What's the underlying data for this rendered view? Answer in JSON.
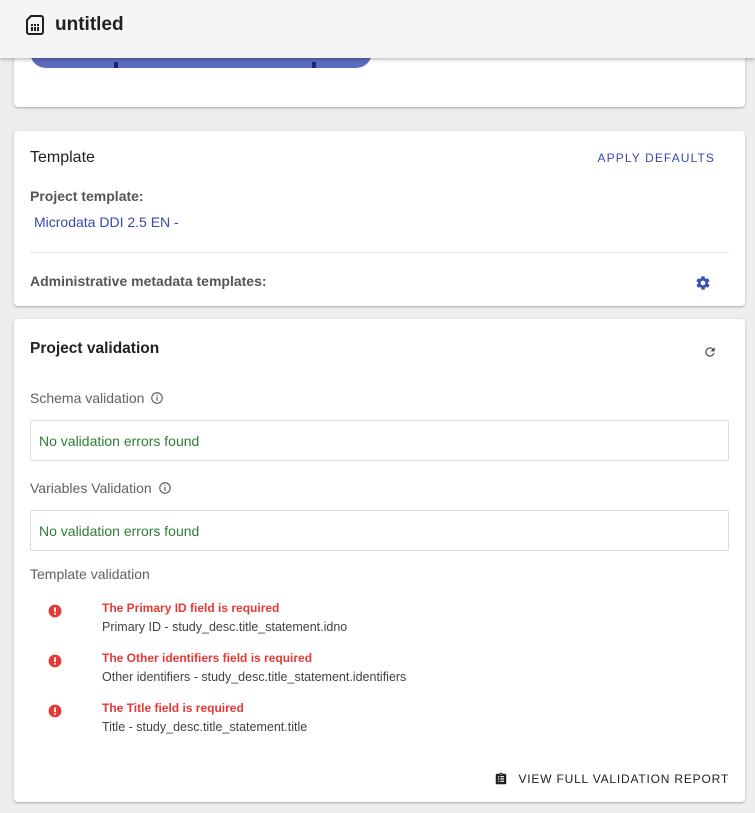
{
  "app": {
    "title": "untitled",
    "icon": "sim-card-icon"
  },
  "template_card": {
    "title": "Template",
    "apply_defaults": "APPLY DEFAULTS",
    "project_template_label": "Project template:",
    "project_template_value": "Microdata DDI 2.5 EN -",
    "admin_label": "Administrative metadata templates:",
    "settings_icon": "gear-icon"
  },
  "validation_card": {
    "title": "Project validation",
    "refresh_icon": "refresh-icon",
    "schema": {
      "label": "Schema validation",
      "result": "No validation errors found"
    },
    "variables": {
      "label": "Variables Validation",
      "result": "No validation errors found"
    },
    "template": {
      "label": "Template validation",
      "errors": [
        {
          "title": "The Primary ID field is required",
          "desc": "Primary ID - study_desc.title_statement.idno"
        },
        {
          "title": "The Other identifiers field is required",
          "desc": "Other identifiers - study_desc.title_statement.identifiers"
        },
        {
          "title": "The Title field is required",
          "desc": "Title - study_desc.title_statement.title"
        }
      ]
    },
    "report_button": "VIEW FULL VALIDATION REPORT"
  },
  "colors": {
    "accent": "#3949ab",
    "success": "#2e7d32",
    "error": "#e53935",
    "pill": "#5c6bc0"
  }
}
